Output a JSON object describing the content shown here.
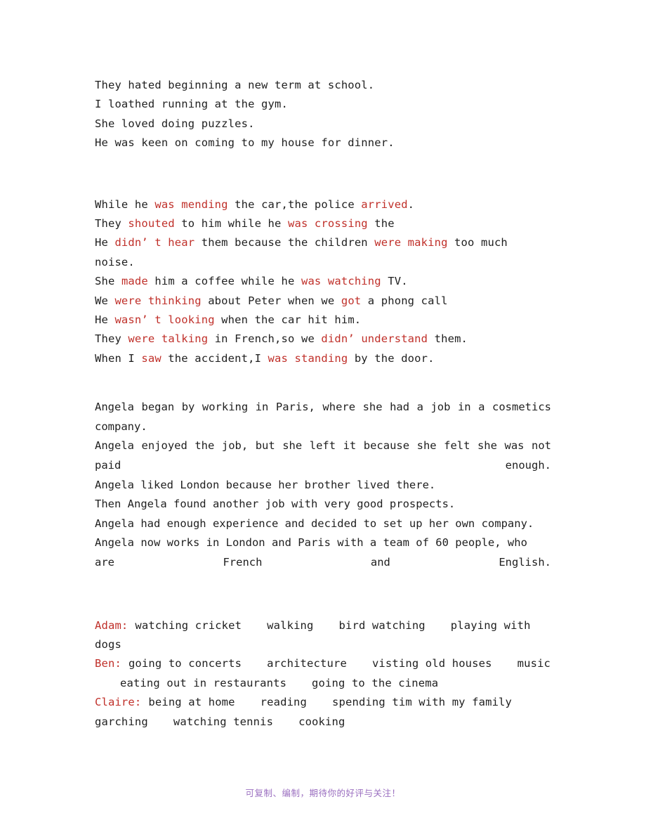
{
  "document": {
    "background_color": "#ffffff",
    "text_color": "#1f1f1f",
    "highlight_color": "#c0302a",
    "footer_color": "#9b6fc0"
  },
  "block_gerunds": {
    "lines": [
      "They hated beginning a new term at school.",
      "I loathed running at the gym.",
      "She loved doing puzzles.",
      "He was keen on coming to my house for dinner."
    ]
  },
  "block_past_continuous": {
    "lines": [
      [
        {
          "t": "While he ",
          "red": false
        },
        {
          "t": "was mending",
          "red": true
        },
        {
          "t": " the car,the police ",
          "red": false
        },
        {
          "t": "arrived",
          "red": true
        },
        {
          "t": ".",
          "red": false
        }
      ],
      [
        {
          "t": "They ",
          "red": false
        },
        {
          "t": "shouted",
          "red": true
        },
        {
          "t": " to him while he ",
          "red": false
        },
        {
          "t": "was crossing",
          "red": true
        },
        {
          "t": " the",
          "red": false
        }
      ],
      [
        {
          "t": "He ",
          "red": false
        },
        {
          "t": "didn’ t hear",
          "red": true
        },
        {
          "t": " them because the children ",
          "red": false
        },
        {
          "t": "were making",
          "red": true
        },
        {
          "t": " too much noise.",
          "red": false
        }
      ],
      [
        {
          "t": "She ",
          "red": false
        },
        {
          "t": "made",
          "red": true
        },
        {
          "t": " him a coffee while he ",
          "red": false
        },
        {
          "t": "was watching",
          "red": true
        },
        {
          "t": " TV.",
          "red": false
        }
      ],
      [
        {
          "t": "We ",
          "red": false
        },
        {
          "t": "were thinking",
          "red": true
        },
        {
          "t": " about Peter when we ",
          "red": false
        },
        {
          "t": "got",
          "red": true
        },
        {
          "t": " a phong call",
          "red": false
        }
      ],
      [
        {
          "t": "He ",
          "red": false
        },
        {
          "t": "wasn’ t looking",
          "red": true
        },
        {
          "t": " when the car hit him.",
          "red": false
        }
      ],
      [
        {
          "t": "They ",
          "red": false
        },
        {
          "t": "were talking",
          "red": true
        },
        {
          "t": " in French,so we ",
          "red": false
        },
        {
          "t": "didn’ understand",
          "red": true
        },
        {
          "t": " them.",
          "red": false
        }
      ],
      [
        {
          "t": "When I ",
          "red": false
        },
        {
          "t": "saw",
          "red": true
        },
        {
          "t": " the accident,I ",
          "red": false
        },
        {
          "t": "was standing",
          "red": true
        },
        {
          "t": " by the door.",
          "red": false
        }
      ]
    ]
  },
  "block_angela": {
    "lines": [
      "Angela began by working in Paris, where she had a job in a cosmetics company.",
      "Angela enjoyed the job, but she left it because she felt she was not paid enough.",
      "Angela liked London because her brother lived there.",
      "Then Angela found another job with very good prospects.",
      "Angela had enough experience and decided to set up her own company.",
      "Angela now works in London and Paris with a team of 60 people, who are French and English."
    ]
  },
  "block_hobbies": {
    "entries": [
      {
        "name": "Adam:",
        "items": [
          "watching cricket",
          "walking",
          "bird watching",
          "playing with dogs"
        ]
      },
      {
        "name": "Ben:",
        "items": [
          "going to concerts",
          "architecture",
          "visting old houses",
          "music",
          "eating out in restaurants",
          "going to the cinema"
        ]
      },
      {
        "name": "Claire:",
        "items": [
          "being at home",
          "reading",
          "spending tim with my family",
          "garching",
          "watching tennis",
          "cooking"
        ]
      }
    ]
  },
  "footer": {
    "text": "可复制、编制，期待你的好评与关注！"
  }
}
